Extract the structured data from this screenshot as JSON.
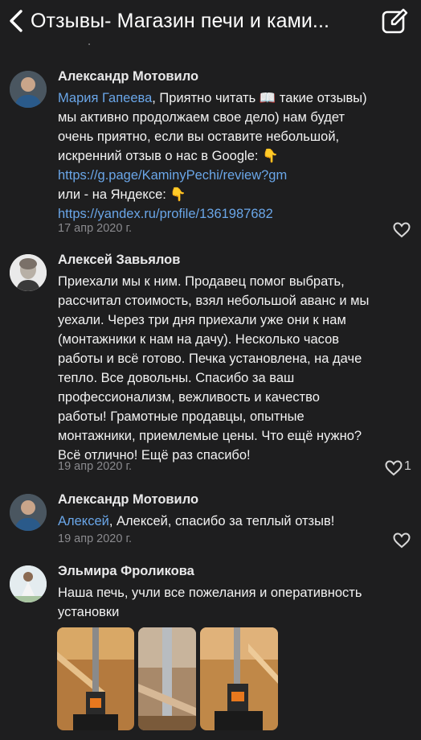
{
  "header": {
    "title": "Отзывы- Магазин печи и ками..."
  },
  "cut_comment": {
    "date": "17 апр 2020 г.",
    "heart_glyph": "♡"
  },
  "comments": [
    {
      "author": "Александр Мотовило",
      "lines": [
        {
          "mention": "Мария Гапеева",
          "text": ", Приятно читать 📖 такие отзывы)"
        },
        {
          "text": "мы активно продолжаем свое дело)  нам будет"
        },
        {
          "text": "очень приятно, если вы оставите небольшой,"
        },
        {
          "text": "искренний отзыв о нас в  Google: 👇"
        },
        {
          "link": "https://g.page/KaminyPechi/review?gm"
        },
        {
          "text": " или -  на Яндексе: 👇"
        },
        {
          "link": "https://yandex.ru/profile/1361987682"
        }
      ],
      "date": "17 апр 2020 г.",
      "likes": ""
    },
    {
      "author": "Алексей Завьялов",
      "lines": [
        {
          "text": "Приехали мы к ним. Продавец помог выбрать,"
        },
        {
          "text": "рассчитал стоимость, взял небольшой аванс и мы"
        },
        {
          "text": "уехали. Через три дня приехали уже они к нам"
        },
        {
          "text": "(монтажники к нам на дачу). Несколько часов"
        },
        {
          "text": "работы и всё готово. Печка установлена, на даче"
        },
        {
          "text": "тепло. Все довольны. Спасибо за ваш"
        },
        {
          "text": "профессионализм, вежливость и качество"
        },
        {
          "text": "работы! Грамотные продавцы, опытные"
        },
        {
          "text": "монтажники, приемлемые цены. Что ещё нужно?"
        },
        {
          "text": "Всё отлично! Ещё раз спасибо!"
        }
      ],
      "date": "19 апр 2020 г.",
      "likes": "1"
    },
    {
      "author": "Александр Мотовило",
      "lines": [
        {
          "mention": "Алексей",
          "text": ", Алексей, спасибо за теплый отзыв!"
        }
      ],
      "date": "19 апр 2020 г.",
      "likes": ""
    },
    {
      "author": "Эльмира Фроликова",
      "lines": [
        {
          "text": "Наша печь, учли все пожелания и оперативность"
        },
        {
          "text": "установки"
        }
      ],
      "date": "",
      "likes": "",
      "photos": 3
    }
  ],
  "colors": {
    "background": "#1e1e1f",
    "mention": "#6aa6e8",
    "secondary_text": "#8a8a8e"
  },
  "icons": [
    "back-chevron-icon",
    "edit-icon",
    "heart-icon"
  ]
}
